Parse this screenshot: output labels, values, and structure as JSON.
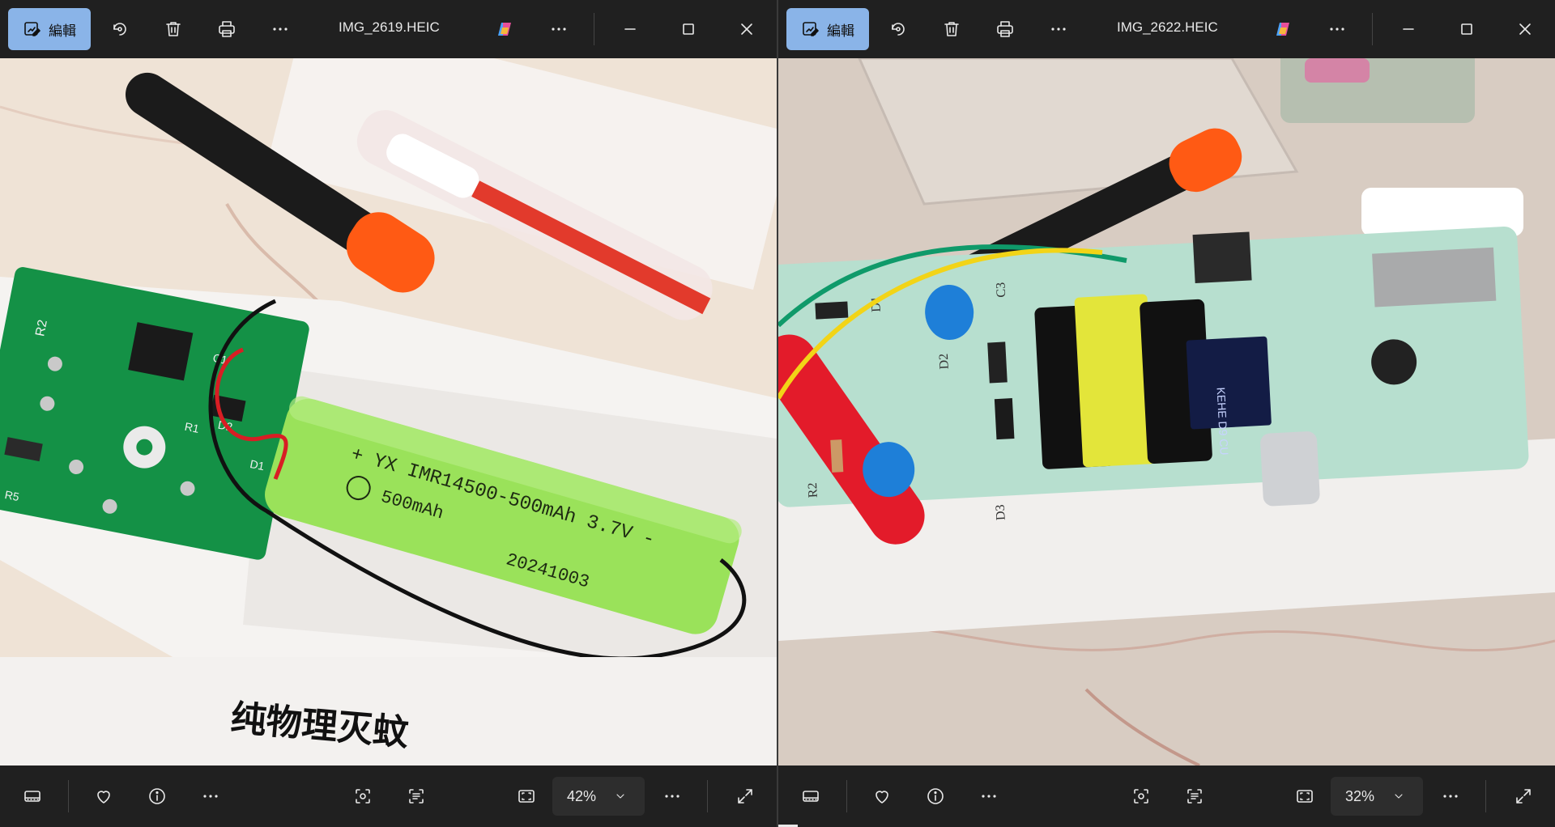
{
  "left": {
    "edit_label": "編輯",
    "filename": "IMG_2619.HEIC",
    "zoom": "42%",
    "photo": {
      "battery_line1": "+ YX IMR14500-500mAh 3.7V -",
      "battery_line2": "500mAh",
      "battery_line3": "20241003",
      "box_text": "纯物理灭蚊",
      "pcb_labels": [
        "R2",
        "C1",
        "D2",
        "R1",
        "D1",
        "R5"
      ]
    }
  },
  "right": {
    "edit_label": "編輯",
    "filename": "IMG_2622.HEIC",
    "zoom": "32%",
    "photo": {
      "ic_text": "KEHE D9 CU",
      "pcb_labels": [
        "D1",
        "D2",
        "C3",
        "R2",
        "D3"
      ]
    }
  },
  "icons": {
    "edit": "edit-photo-icon",
    "rotate": "rotate-icon",
    "delete": "trash-icon",
    "print": "print-icon",
    "more": "more-icon",
    "copilot": "copilot-icon",
    "minimize": "minimize-icon",
    "maximize": "maximize-icon",
    "close": "close-icon",
    "filmstrip": "filmstrip-icon",
    "favorite": "heart-icon",
    "info": "info-icon",
    "visual_search": "visual-search-icon",
    "text_scan": "scan-text-icon",
    "fit": "fit-window-icon",
    "fullscreen": "fullscreen-icon"
  }
}
